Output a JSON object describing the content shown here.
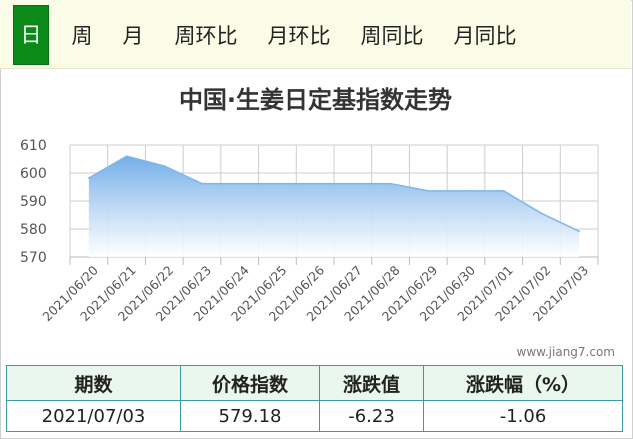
{
  "tabs": [
    {
      "label": "日",
      "active": true
    },
    {
      "label": "周",
      "active": false
    },
    {
      "label": "月",
      "active": false
    },
    {
      "label": "周环比",
      "active": false
    },
    {
      "label": "月环比",
      "active": false
    },
    {
      "label": "周同比",
      "active": false
    },
    {
      "label": "月同比",
      "active": false
    }
  ],
  "chart_data": {
    "type": "area",
    "title": "中国·生姜日定基指数走势",
    "xlabel": "",
    "ylabel": "",
    "categories": [
      "2021/06/20",
      "2021/06/21",
      "2021/06/22",
      "2021/06/23",
      "2021/06/24",
      "2021/06/25",
      "2021/06/26",
      "2021/06/27",
      "2021/06/28",
      "2021/06/29",
      "2021/06/30",
      "2021/07/01",
      "2021/07/02",
      "2021/07/03"
    ],
    "series": [
      {
        "values": [
          598.2,
          606.0,
          602.5,
          596.2,
          596.2,
          596.2,
          596.2,
          596.2,
          596.2,
          593.6,
          593.6,
          593.6,
          585.6,
          579.18
        ]
      }
    ],
    "ylim": [
      570,
      610
    ],
    "yticks": [
      570,
      580,
      590,
      600,
      610
    ],
    "grid": true,
    "colors": {
      "line": "#7fb6ea",
      "fill_top": "#74aee8",
      "fill_bottom": "#ffffff",
      "grid": "#cccccc"
    }
  },
  "watermark": "www.jiang7.com",
  "table": {
    "headers": [
      "期数",
      "价格指数",
      "涨跌值",
      "涨跌幅（%）"
    ],
    "row": [
      "2021/07/03",
      "579.18",
      "-6.23",
      "-1.06"
    ]
  }
}
